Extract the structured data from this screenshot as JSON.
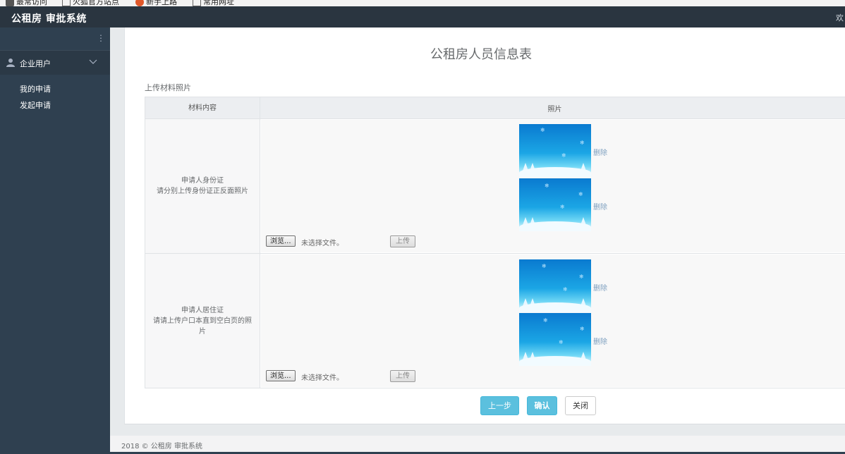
{
  "bookmarks": [
    {
      "label": "最常访问",
      "icon": "bookmark-icon"
    },
    {
      "label": "火狐官方站点",
      "icon": "folder-icon"
    },
    {
      "label": "新手上路",
      "icon": "firefox-icon"
    },
    {
      "label": "常用网址",
      "icon": "folder-icon"
    }
  ],
  "header": {
    "brand": "公租房 审批系统",
    "right_text": "欢"
  },
  "sidebar": {
    "menu_title": "企业用户",
    "items": [
      {
        "label": "我的申请"
      },
      {
        "label": "发起申请"
      }
    ]
  },
  "form": {
    "title": "公租房人员信息表",
    "section_label": "上传材料照片",
    "table": {
      "headers": [
        "材料内容",
        "照片"
      ],
      "rows": [
        {
          "desc_line1": "申请人身份证",
          "desc_line2": "请分别上传身份证正反面照片",
          "photos": [
            {
              "delete_label": "删除"
            },
            {
              "delete_label": "删除"
            }
          ],
          "browse_label": "浏览...",
          "no_file": "未选择文件。",
          "upload_label": "上传"
        },
        {
          "desc_line1": "申请人居住证",
          "desc_line2": "请请上传户口本直到空白页的照片",
          "photos": [
            {
              "delete_label": "删除"
            },
            {
              "delete_label": "删除"
            }
          ],
          "browse_label": "浏览...",
          "no_file": "未选择文件。",
          "upload_label": "上传"
        }
      ]
    },
    "buttons": {
      "prev": "上一步",
      "confirm": "确认",
      "close": "关闭"
    }
  },
  "footer": {
    "text": "2018 © 公租房 审批系统"
  },
  "colors": {
    "sidebar_bg": "#2f4050",
    "topbar_bg": "#2a3540",
    "primary_button": "#5bc0de",
    "content_bg": "#e7eaec"
  }
}
